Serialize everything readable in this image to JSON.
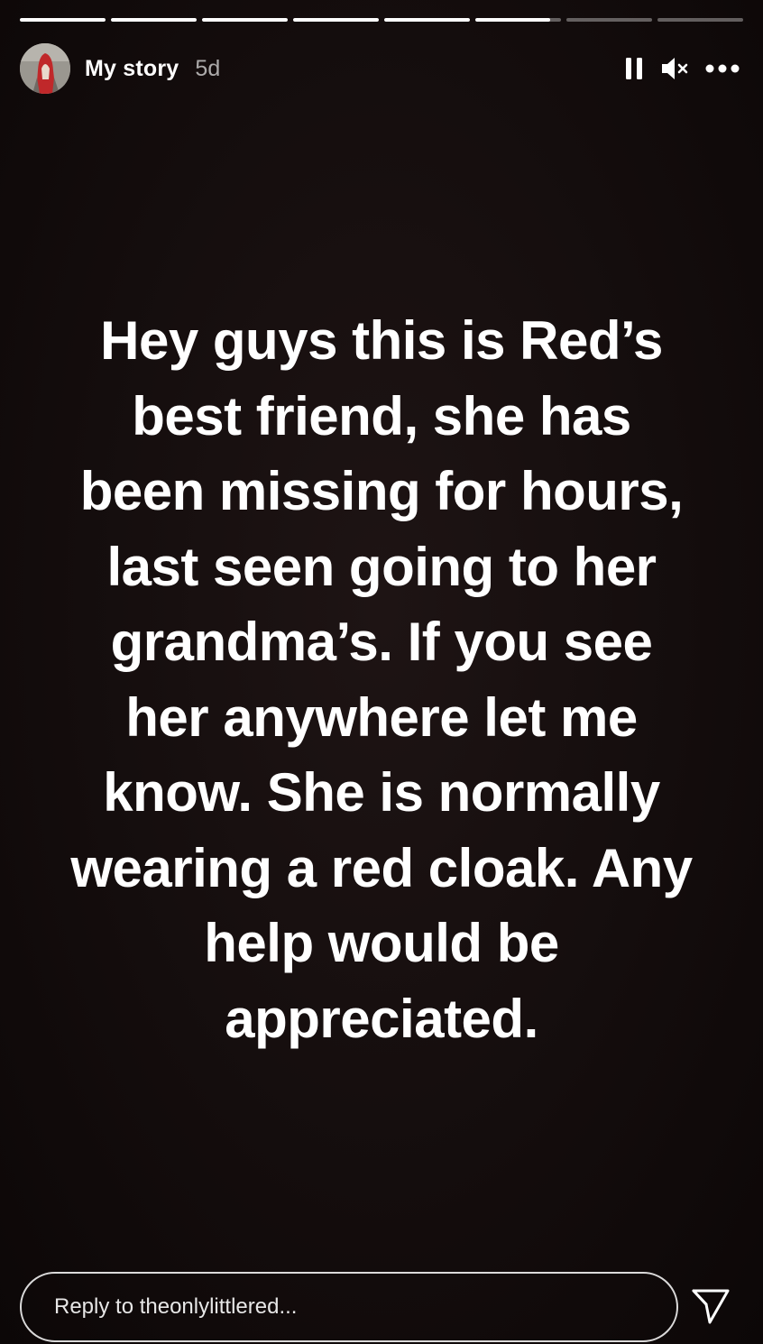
{
  "story": {
    "segments": [
      1,
      1,
      1,
      1,
      1,
      0.87,
      0,
      0
    ],
    "author_label": "My story",
    "time_ago": "5d"
  },
  "controls": {
    "pause_icon": "pause-icon",
    "mute_icon": "speaker-muted-icon",
    "more_icon": "more-dots-icon"
  },
  "message": {
    "lines": [
      "Hey guys this is Red’s",
      "best friend, she has",
      "been missing for hours,",
      "last seen going to her",
      "grandma’s. If you see",
      "her anywhere let me",
      "know. She is normally",
      "wearing a red cloak. Any",
      "help would be",
      "appreciated."
    ]
  },
  "reply": {
    "placeholder": "Reply to theonlylittlered...",
    "value": ""
  },
  "send_icon": "send-icon",
  "colors": {
    "background": "#140d0d",
    "text": "#ffffff",
    "avatar_red": "#c0282a"
  }
}
